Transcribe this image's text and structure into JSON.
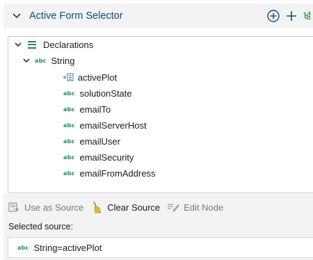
{
  "header": {
    "title": "Active Form Selector",
    "icons": [
      "chevron-down-icon",
      "add-circle-icon",
      "plus-icon",
      "tree-add-icon"
    ]
  },
  "tree": {
    "declarations_label": "Declarations",
    "string_group_label": "String",
    "abc_badge": "abc",
    "items": [
      {
        "label": "activePlot",
        "icon": "form-variable-icon"
      },
      {
        "label": "solutionState",
        "icon": "abc"
      },
      {
        "label": "emailTo",
        "icon": "abc"
      },
      {
        "label": "emailServerHost",
        "icon": "abc"
      },
      {
        "label": "emailUser",
        "icon": "abc"
      },
      {
        "label": "emailSecurity",
        "icon": "abc"
      },
      {
        "label": "emailFromAddress",
        "icon": "abc"
      }
    ]
  },
  "toolbar": {
    "use_as_source": "Use as Source",
    "clear_source": "Clear Source",
    "edit_node": "Edit Node"
  },
  "selected": {
    "label": "Selected source:",
    "value": "String=activePlot",
    "badge": "abc"
  },
  "colors": {
    "accent": "#0a4c8b",
    "icon_green": "#1c8a6b",
    "header_bg": "#f3f3f3",
    "muted_text": "#7a7a7a"
  }
}
